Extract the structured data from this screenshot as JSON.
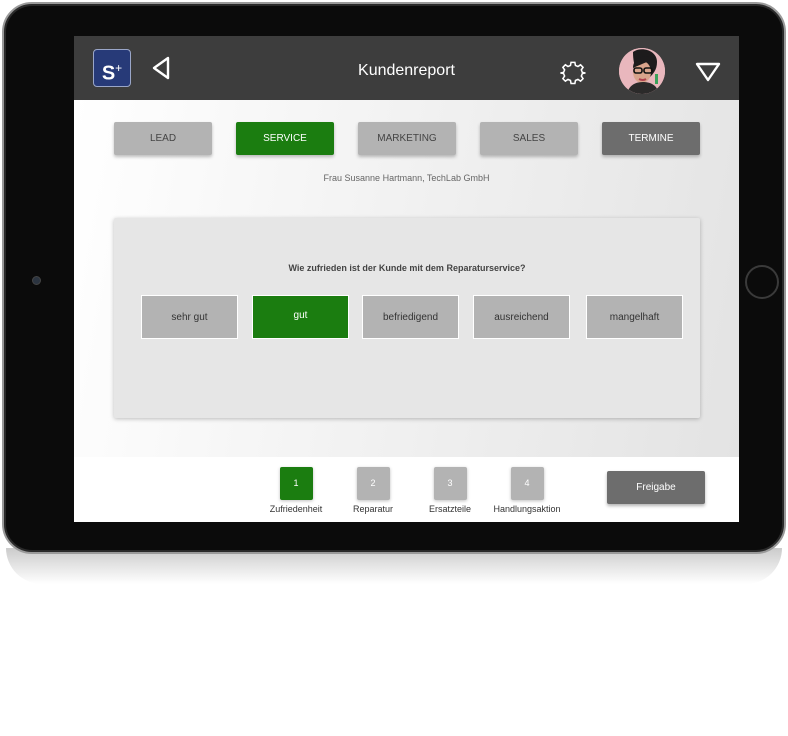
{
  "app": {
    "title": "Kundenreport",
    "logo_letter": "S",
    "logo_plus": "+"
  },
  "icons": {
    "back": "back-triangle-icon",
    "settings": "gear-icon",
    "menu": "dropdown-triangle-icon"
  },
  "colors": {
    "accent_green": "#1b7d10",
    "topbar": "#3d3d3d",
    "inactive": "#b3b3b3",
    "dark_button": "#6d6d6d"
  },
  "tabs": [
    {
      "label": "LEAD",
      "state": "inactive"
    },
    {
      "label": "SERVICE",
      "state": "active"
    },
    {
      "label": "MARKETING",
      "state": "inactive"
    },
    {
      "label": "SALES",
      "state": "inactive"
    },
    {
      "label": "TERMINE",
      "state": "dark"
    }
  ],
  "customer": "Frau Susanne Hartmann, TechLab GmbH",
  "survey": {
    "question": "Wie zufrieden ist der Kunde mit dem Reparaturservice?",
    "options": [
      "sehr gut",
      "gut",
      "befriedigend",
      "ausreichend",
      "mangelhaft"
    ],
    "selected": "gut"
  },
  "steps": [
    {
      "number": "1",
      "label": "Zufriedenheit",
      "active": true
    },
    {
      "number": "2",
      "label": "Reparatur",
      "active": false
    },
    {
      "number": "3",
      "label": "Ersatzteile",
      "active": false
    },
    {
      "number": "4",
      "label": "Handlungsaktion",
      "active": false
    }
  ],
  "release_button": "Freigabe"
}
